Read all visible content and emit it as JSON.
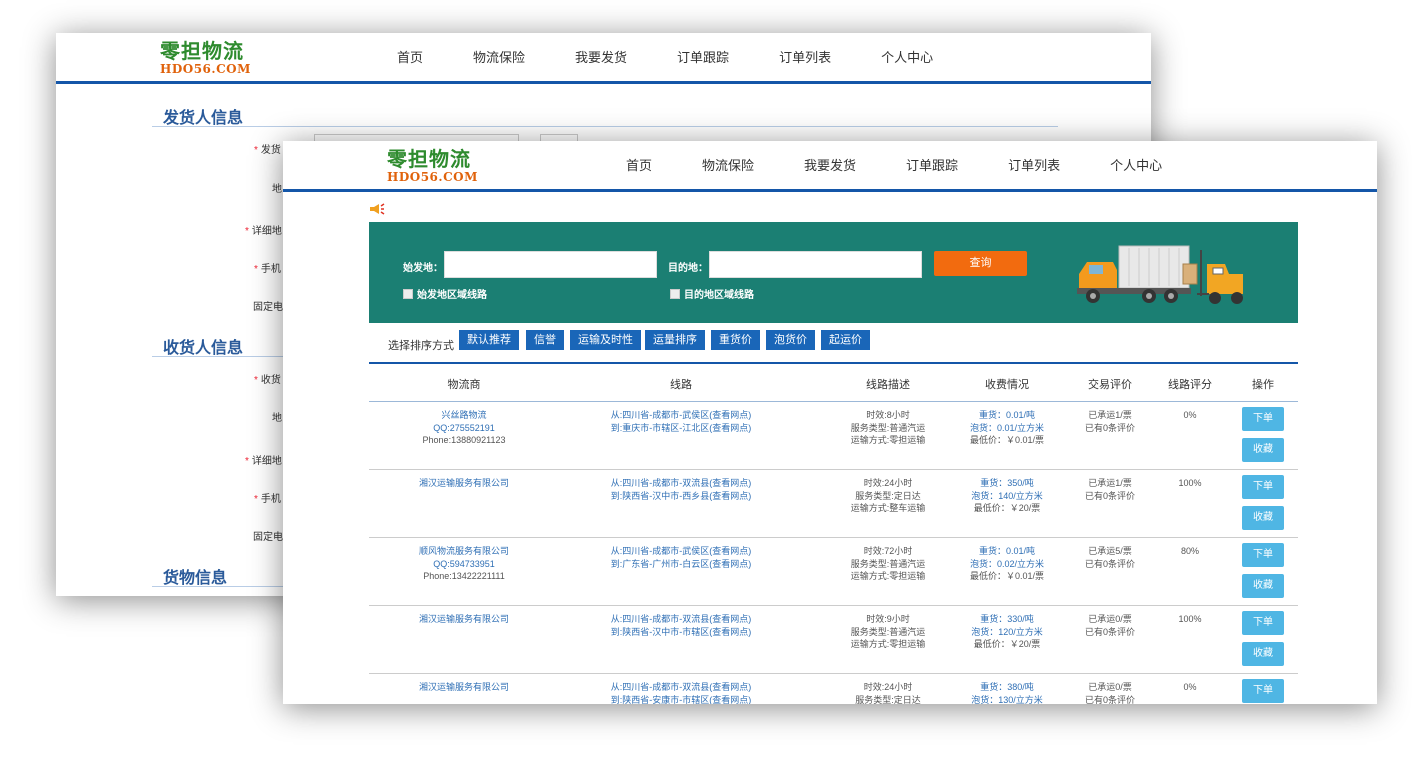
{
  "logo": {
    "title": "零担物流",
    "subtitle": "HDO56.COM"
  },
  "nav": [
    "首页",
    "物流保险",
    "我要发货",
    "订单跟踪",
    "订单列表",
    "个人中心"
  ],
  "back_form": {
    "sender_title": "发货人信息",
    "receiver_title": "收货人信息",
    "cargo_title": "货物信息",
    "sender_fields": [
      "发货",
      "地",
      "详细地",
      "手机",
      "固定电"
    ],
    "receiver_fields": [
      "收货",
      "地",
      "详细地",
      "手机",
      "固定电"
    ]
  },
  "search": {
    "origin_label": "始发地：",
    "dest_label": "目的地：",
    "origin_checkbox": "始发地区域线路",
    "dest_checkbox": "目的地区域线路",
    "query_button": "查询",
    "origin_value": "",
    "dest_value": ""
  },
  "sort": {
    "label": "选择排序方式",
    "buttons": [
      "默认推荐",
      "信誉",
      "运输及时性",
      "运量排序",
      "重货价",
      "泡货价",
      "起运价"
    ]
  },
  "table": {
    "headers": [
      "物流商",
      "线路",
      "线路描述",
      "收费情况",
      "交易评价",
      "线路评分",
      "操作"
    ],
    "rows": [
      {
        "company": "兴丝路物流",
        "qq": "QQ:275552191",
        "phone": "Phone:13880921123",
        "from": "从:四川省-成都市-武侯区(查看网点)",
        "to": "到:重庆市-市辖区-江北区(查看网点)",
        "time": "时效:8小时",
        "service": "服务类型:普通汽运",
        "mode": "运输方式:零担运输",
        "heavy": "重货：0.01/吨",
        "bulk": "泡货：0.01/立方米",
        "min": "最低价：￥0.01/票",
        "shipped": "已承运1/票",
        "reviews": "已有0条评价",
        "score": "0%",
        "order": "下单",
        "fav": "收藏"
      },
      {
        "company": "湘汉运输服务有限公司",
        "qq": "",
        "phone": "",
        "from": "从:四川省-成都市-双流县(查看网点)",
        "to": "到:陕西省-汉中市-西乡县(查看网点)",
        "time": "时效:24小时",
        "service": "服务类型:定日达",
        "mode": "运输方式:整车运输",
        "heavy": "重货：350/吨",
        "bulk": "泡货：140/立方米",
        "min": "最低价：￥20/票",
        "shipped": "已承运1/票",
        "reviews": "已有0条评价",
        "score": "100%",
        "order": "下单",
        "fav": "收藏"
      },
      {
        "company": "顺风物流服务有限公司",
        "qq": "QQ:594733951",
        "phone": "Phone:13422221111",
        "from": "从:四川省-成都市-武侯区(查看网点)",
        "to": "到:广东省-广州市-白云区(查看网点)",
        "time": "时效:72小时",
        "service": "服务类型:普通汽运",
        "mode": "运输方式:零担运输",
        "heavy": "重货：0.01/吨",
        "bulk": "泡货：0.02/立方米",
        "min": "最低价：￥0.01/票",
        "shipped": "已承运5/票",
        "reviews": "已有0条评价",
        "score": "80%",
        "order": "下单",
        "fav": "收藏"
      },
      {
        "company": "湘汉运输服务有限公司",
        "qq": "",
        "phone": "",
        "from": "从:四川省-成都市-双流县(查看网点)",
        "to": "到:陕西省-汉中市-市辖区(查看网点)",
        "time": "时效:9小时",
        "service": "服务类型:普通汽运",
        "mode": "运输方式:零担运输",
        "heavy": "重货：330/吨",
        "bulk": "泡货：120/立方米",
        "min": "最低价：￥20/票",
        "shipped": "已承运0/票",
        "reviews": "已有0条评价",
        "score": "100%",
        "order": "下单",
        "fav": "收藏"
      },
      {
        "company": "湘汉运输服务有限公司",
        "qq": "",
        "phone": "",
        "from": "从:四川省-成都市-双流县(查看网点)",
        "to": "到:陕西省-安康市-市辖区(查看网点)",
        "time": "时效:24小时",
        "service": "服务类型:定日达",
        "mode": "",
        "heavy": "重货：380/吨",
        "bulk": "泡货：130/立方米",
        "min": "",
        "shipped": "已承运0/票",
        "reviews": "已有0条评价",
        "score": "0%",
        "order": "下单",
        "fav": ""
      }
    ]
  },
  "colors": {
    "nav_border": "#1456a8",
    "search_bg": "#1b7f73",
    "query_button": "#f26b0f",
    "sort_button": "#1a66b8",
    "action_button": "#4fb6e4",
    "link": "#2f6fb5"
  }
}
